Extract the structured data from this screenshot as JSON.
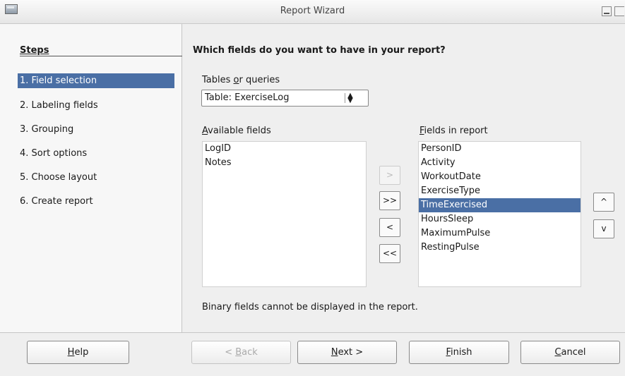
{
  "window": {
    "title": "Report Wizard"
  },
  "steps": {
    "title": "Steps",
    "items": [
      {
        "label": "1. Field selection",
        "active": true
      },
      {
        "label": "2. Labeling fields"
      },
      {
        "label": "3. Grouping"
      },
      {
        "label": "4. Sort options"
      },
      {
        "label": "5. Choose layout"
      },
      {
        "label": "6. Create report"
      }
    ]
  },
  "main": {
    "question": "Which fields do you want to have in your report?",
    "tables_label_pre": "Tables ",
    "tables_label_u": "o",
    "tables_label_post": "r queries",
    "table_value": "Table: ExerciseLog",
    "available_label_u": "A",
    "available_label_post": "vailable fields",
    "fields_label_u": "F",
    "fields_label_post": "ields in report",
    "available_fields": [
      "LogID",
      "Notes"
    ],
    "report_fields": [
      "PersonID",
      "Activity",
      "WorkoutDate",
      "ExerciseType",
      "TimeExercised",
      "HoursSleep",
      "MaximumPulse",
      "RestingPulse"
    ],
    "selected_report_field": "TimeExercised",
    "note": "Binary fields cannot be displayed in the report."
  },
  "move_buttons": {
    "add": ">",
    "add_all": ">>",
    "remove": "<",
    "remove_all": "<<",
    "up": "^",
    "down": "v"
  },
  "footer": {
    "help_u": "H",
    "help_post": "elp",
    "back_pre": "< ",
    "back_u": "B",
    "back_post": "ack",
    "next_u": "N",
    "next_post": "ext >",
    "finish_u": "F",
    "finish_post": "inish",
    "cancel_u": "C",
    "cancel_post": "ancel"
  }
}
